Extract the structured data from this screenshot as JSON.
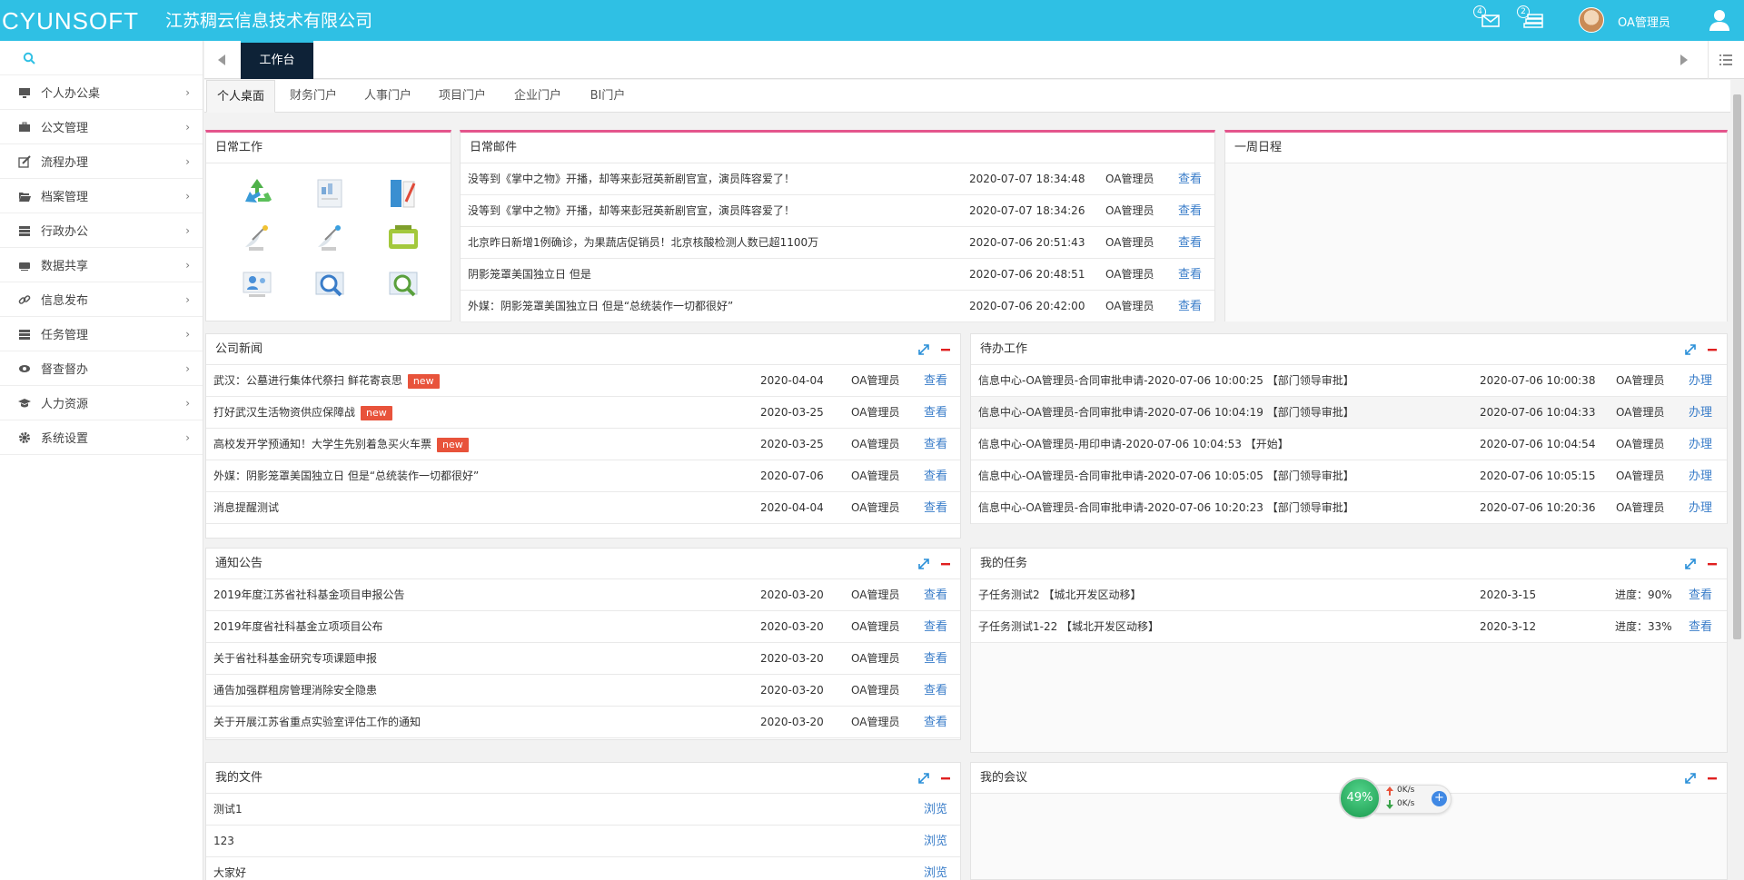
{
  "header": {
    "logo": "CYUNSOFT",
    "company": "江苏稠云信息技术有限公司",
    "mail_count": "4",
    "msg_count": "2",
    "username": "OA管理员"
  },
  "sidebar": {
    "items": [
      {
        "label": "个人办公桌"
      },
      {
        "label": "公文管理"
      },
      {
        "label": "流程办理"
      },
      {
        "label": "档案管理"
      },
      {
        "label": "行政办公"
      },
      {
        "label": "数据共享"
      },
      {
        "label": "信息发布"
      },
      {
        "label": "任务管理"
      },
      {
        "label": "督查督办"
      },
      {
        "label": "人力资源"
      },
      {
        "label": "系统设置"
      }
    ]
  },
  "tabs": {
    "active": "工作台"
  },
  "subtabs": [
    "个人桌面",
    "财务门户",
    "人事门户",
    "项目门户",
    "企业门户",
    "BI门户"
  ],
  "daily_work": {
    "title": "日常工作"
  },
  "daily_mail": {
    "title": "日常邮件",
    "rows": [
      {
        "title": "没等到《掌中之物》开播，却等来彭冠英新剧官宣，演员阵容爱了！",
        "time": "2020-07-07 18:34:48",
        "user": "OA管理员",
        "action": "查看"
      },
      {
        "title": "没等到《掌中之物》开播，却等来彭冠英新剧官宣，演员阵容爱了！",
        "time": "2020-07-07 18:34:26",
        "user": "OA管理员",
        "action": "查看"
      },
      {
        "title": "北京昨日新增1例确诊，为果蔬店促销员！北京核酸检测人数已超1100万",
        "time": "2020-07-06 20:51:43",
        "user": "OA管理员",
        "action": "查看"
      },
      {
        "title": "阴影笼罩美国独立日 但是",
        "time": "2020-07-06 20:48:51",
        "user": "OA管理员",
        "action": "查看"
      },
      {
        "title": "外媒：阴影笼罩美国独立日 但是“总统装作一切都很好”",
        "time": "2020-07-06 20:42:00",
        "user": "OA管理员",
        "action": "查看"
      }
    ]
  },
  "week_schedule": {
    "title": "一周日程"
  },
  "company_news": {
    "title": "公司新闻",
    "new_label": "new",
    "rows": [
      {
        "title": "武汉：公墓进行集体代祭扫 鲜花寄哀思",
        "new": true,
        "date": "2020-04-04",
        "user": "OA管理员",
        "action": "查看"
      },
      {
        "title": "打好武汉生活物资供应保障战",
        "new": true,
        "date": "2020-03-25",
        "user": "OA管理员",
        "action": "查看"
      },
      {
        "title": "高校发开学预通知！大学生先别着急买火车票",
        "new": true,
        "date": "2020-03-25",
        "user": "OA管理员",
        "action": "查看"
      },
      {
        "title": "外媒：阴影笼罩美国独立日 但是“总统装作一切都很好”",
        "new": false,
        "date": "2020-07-06",
        "user": "OA管理员",
        "action": "查看"
      },
      {
        "title": "消息提醒测试",
        "new": false,
        "date": "2020-04-04",
        "user": "OA管理员",
        "action": "查看"
      }
    ]
  },
  "todo_work": {
    "title": "待办工作",
    "rows": [
      {
        "title": "信息中心-OA管理员-合同审批申请-2020-07-06 10:00:25 【部门领导审批】",
        "time": "2020-07-06 10:00:38",
        "user": "OA管理员",
        "action": "办理"
      },
      {
        "title": "信息中心-OA管理员-合同审批申请-2020-07-06 10:04:19 【部门领导审批】",
        "time": "2020-07-06 10:04:33",
        "user": "OA管理员",
        "action": "办理"
      },
      {
        "title": "信息中心-OA管理员-用印申请-2020-07-06 10:04:53 【开始】",
        "time": "2020-07-06 10:04:54",
        "user": "OA管理员",
        "action": "办理"
      },
      {
        "title": "信息中心-OA管理员-合同审批申请-2020-07-06 10:05:05 【部门领导审批】",
        "time": "2020-07-06 10:05:15",
        "user": "OA管理员",
        "action": "办理"
      },
      {
        "title": "信息中心-OA管理员-合同审批申请-2020-07-06 10:20:23 【部门领导审批】",
        "time": "2020-07-06 10:20:36",
        "user": "OA管理员",
        "action": "办理"
      }
    ]
  },
  "notices": {
    "title": "通知公告",
    "rows": [
      {
        "title": "2019年度江苏省社科基金项目申报公告",
        "date": "2020-03-20",
        "user": "OA管理员",
        "action": "查看"
      },
      {
        "title": "2019年度省社科基金立项项目公布",
        "date": "2020-03-20",
        "user": "OA管理员",
        "action": "查看"
      },
      {
        "title": "关于省社科基金研究专项课题申报",
        "date": "2020-03-20",
        "user": "OA管理员",
        "action": "查看"
      },
      {
        "title": "通告加强群租房管理消除安全隐患",
        "date": "2020-03-20",
        "user": "OA管理员",
        "action": "查看"
      },
      {
        "title": "关于开展江苏省重点实验室评估工作的通知",
        "date": "2020-03-20",
        "user": "OA管理员",
        "action": "查看"
      }
    ]
  },
  "my_tasks": {
    "title": "我的任务",
    "rows": [
      {
        "title": "子任务测试2 【城北开发区动移】",
        "date": "2020-3-15",
        "progress": "进度：90%",
        "action": "查看"
      },
      {
        "title": "子任务测试1-22 【城北开发区动移】",
        "date": "2020-3-12",
        "progress": "进度：33%",
        "action": "查看"
      }
    ]
  },
  "my_files": {
    "title": "我的文件",
    "rows": [
      {
        "title": "测试1",
        "action": "浏览"
      },
      {
        "title": "123",
        "action": "浏览"
      },
      {
        "title": "大家好",
        "action": "浏览"
      }
    ]
  },
  "my_meetings": {
    "title": "我的会议"
  },
  "net_widget": {
    "percent": "49%",
    "up": "0K/s",
    "down": "0K/s"
  },
  "colors": {
    "header": "#2fc0e4",
    "accent_pink": "#e4558c",
    "link": "#3a7dc9",
    "badge": "#e8533b",
    "active_tab": "#0e2237"
  }
}
